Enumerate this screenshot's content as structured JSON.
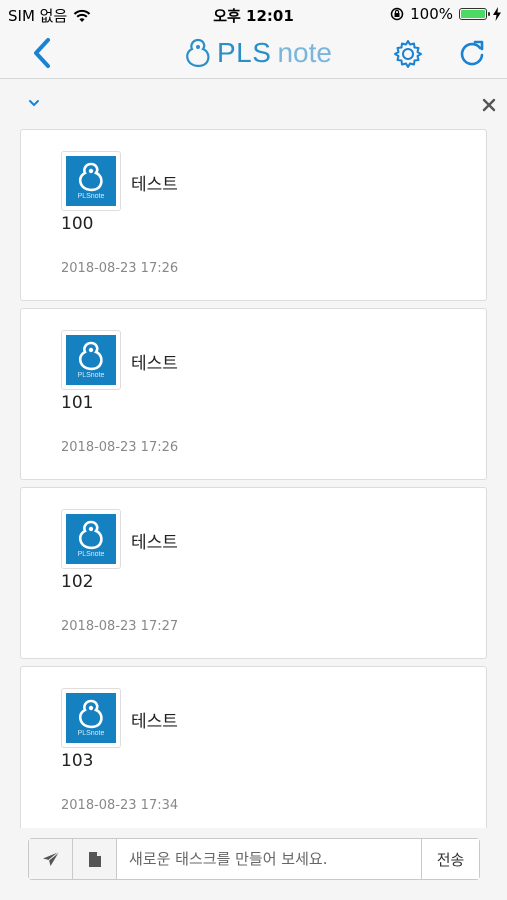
{
  "status_bar": {
    "carrier": "SIM 없음",
    "time": "오후 12:01",
    "battery_percent": "100%",
    "battery_level": 1.0
  },
  "nav": {
    "logo_bold": "PLS",
    "logo_light": "note",
    "accent_color": "#1a82d2"
  },
  "cards": [
    {
      "author": "테스트",
      "body": "100",
      "time": "2018-08-23 17:26",
      "avatar_caption": "PLSnote"
    },
    {
      "author": "테스트",
      "body": "101",
      "time": "2018-08-23 17:26",
      "avatar_caption": "PLSnote"
    },
    {
      "author": "테스트",
      "body": "102",
      "time": "2018-08-23 17:27",
      "avatar_caption": "PLSnote"
    },
    {
      "author": "테스트",
      "body": "103",
      "time": "2018-08-23 17:34",
      "avatar_caption": "PLSnote"
    }
  ],
  "composer": {
    "placeholder": "새로운 태스크를 만들어 보세요.",
    "value": "",
    "send_label": "전송"
  }
}
